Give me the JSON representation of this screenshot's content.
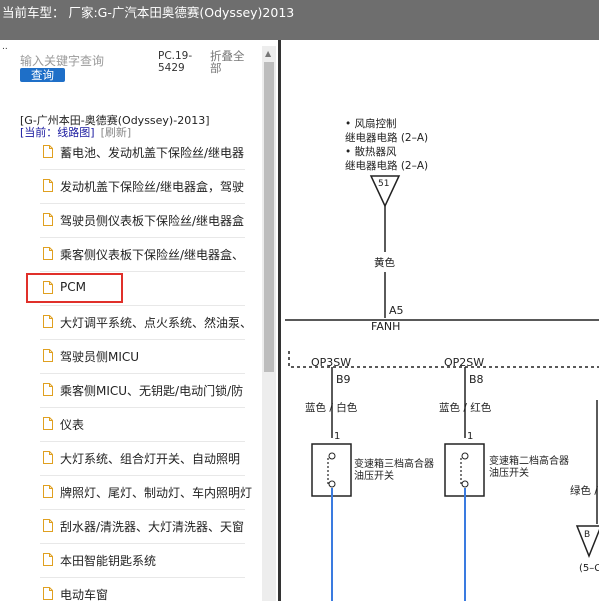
{
  "header": {
    "title": "当前车型：  厂家:G-广汽本田奥德赛(Odyssey)2013"
  },
  "search": {
    "placeholder": "输入关键字查询",
    "button_label": "查询",
    "version": "PC.19-5429",
    "collapse_all": "折叠全部"
  },
  "breadcrumb": {
    "vehicle": "[G-广州本田-奥德赛(Odyssey)-2013]",
    "current_label": "[当前：线路图]",
    "refresh": "[刷新]"
  },
  "tree": {
    "items": [
      {
        "label": "蓄电池、发动机盖下保险丝/继电器"
      },
      {
        "label": "发动机盖下保险丝/继电器盒，驾驶"
      },
      {
        "label": "驾驶员侧仪表板下保险丝/继电器盒"
      },
      {
        "label": "乘客侧仪表板下保险丝/继电器盒、"
      },
      {
        "label": "PCM"
      },
      {
        "label": "大灯调平系统、点火系统、然油泵、"
      },
      {
        "label": "驾驶员侧MICU"
      },
      {
        "label": "乘客侧MICU、无钥匙/电动门锁/防"
      },
      {
        "label": "仪表"
      },
      {
        "label": "大灯系统、组合灯开关、自动照明"
      },
      {
        "label": "牌照灯、尾灯、制动灯、车内照明灯"
      },
      {
        "label": "刮水器/清洗器、大灯清洗器、天窗"
      },
      {
        "label": "本田智能钥匙系统"
      },
      {
        "label": "电动车窗"
      }
    ],
    "selected_index": 4
  },
  "diagram": {
    "note_lines": [
      "• 风扇控制",
      "继电器电路 (2–A)",
      "• 散热器风",
      "继电器电路 (2–A)"
    ],
    "connector_51": "51",
    "wire_yellow": "黄色",
    "pin_a5": "A5",
    "fanh": "FANH",
    "op3sw": "OP3SW",
    "op2sw": "OP2SW",
    "pin_b9": "B9",
    "pin_b8": "B8",
    "wire_blue_white": "蓝色 / 白色",
    "wire_blue_red": "蓝色 / 红色",
    "pin1_left": "1",
    "pin1_right": "1",
    "switch3_label": [
      "变速箱三档高合器",
      "油压开关"
    ],
    "switch2_label": [
      "变速箱二档高合器",
      "油压开关"
    ],
    "wire_green": "绿色 / ",
    "connector_b": "B",
    "partial_ref": "(5–C"
  },
  "colors": {
    "topbar": "#6e6e6e",
    "button": "#1e6fc8",
    "highlight": "#e0302a",
    "wire_blue": "#3a7be0"
  }
}
